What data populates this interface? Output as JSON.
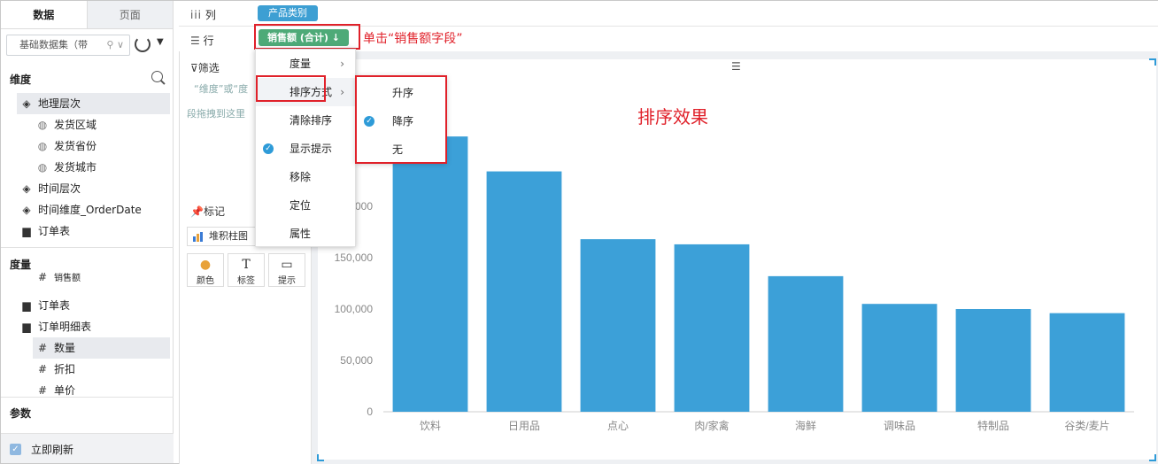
{
  "tabs": [
    "数据",
    "页面"
  ],
  "dataset": {
    "name": "基础数据集（带"
  },
  "dimensions": {
    "title": "维度",
    "items": [
      {
        "label": "地理层次",
        "icon": "layers-icon",
        "level": 0
      },
      {
        "label": "发货区域",
        "icon": "globe-icon",
        "level": 1
      },
      {
        "label": "发货省份",
        "icon": "globe-icon",
        "level": 1
      },
      {
        "label": "发货城市",
        "icon": "globe-icon",
        "level": 1
      },
      {
        "label": "时间层次",
        "icon": "layers-icon",
        "level": 0
      },
      {
        "label": "时间维度_OrderDate",
        "icon": "layers-icon",
        "level": 0
      },
      {
        "label": "订单表",
        "icon": "folder-icon",
        "level": 0
      }
    ]
  },
  "measures": {
    "title": "度量",
    "items": [
      {
        "label": "销售额",
        "icon": "hash-icon",
        "level": 1
      },
      {
        "label": "订单表",
        "icon": "folder-icon",
        "level": 0
      },
      {
        "label": "订单明细表",
        "icon": "folder-open-icon",
        "level": 0
      },
      {
        "label": "数量",
        "icon": "hash-icon",
        "level": 1
      },
      {
        "label": "折扣",
        "icon": "hash-icon",
        "level": 1
      },
      {
        "label": "单价",
        "icon": "hash-icon",
        "level": 1
      }
    ]
  },
  "params": {
    "title": "参数"
  },
  "refresh": {
    "label": "立即刷新"
  },
  "shelves": {
    "columns_label": "列",
    "rows_label": "行",
    "column_pill": "产品类别",
    "row_pill": "销售额 (合计) ↓"
  },
  "annotations": {
    "click_note": "单击“销售额字段”",
    "effect_note": "排序效果"
  },
  "filter": {
    "title": "筛选",
    "hint": "“维度”或“度",
    "hint2": "段拖拽到这里"
  },
  "marks": {
    "title": "标记",
    "chart_type": "堆积柱图",
    "buttons": [
      "颜色",
      "标签",
      "提示"
    ]
  },
  "context_menu": [
    {
      "label": "度量",
      "submenu": true
    },
    {
      "label": "排序方式",
      "submenu": true,
      "highlighted": true
    },
    {
      "label": "清除排序"
    },
    {
      "label": "显示提示",
      "checked": true
    },
    {
      "label": "移除"
    },
    {
      "label": "定位"
    },
    {
      "label": "属性"
    }
  ],
  "sort_menu": [
    {
      "label": "升序"
    },
    {
      "label": "降序",
      "checked": true
    },
    {
      "label": "无"
    }
  ],
  "colors": {
    "bar": "#3ca0d8",
    "accent": "#2e9bd8",
    "annotation": "#e0212a",
    "sales_pill": "#4eaa78",
    "category_pill": "#3d9fd3"
  },
  "chart_data": {
    "type": "bar",
    "categories": [
      "饮料",
      "日用品",
      "点心",
      "肉/家禽",
      "海鲜",
      "调味品",
      "特制品",
      "谷类/麦片"
    ],
    "values": [
      268000,
      234000,
      168000,
      163000,
      132000,
      105000,
      100000,
      96000
    ],
    "ylim": [
      0,
      300000
    ],
    "yticks": [
      0,
      50000,
      100000,
      150000,
      200000,
      250000
    ],
    "ytick_labels": [
      "0",
      "50,000",
      "100,000",
      "150,000",
      "200,000",
      "250,000"
    ],
    "title": "",
    "xlabel": "",
    "ylabel": ""
  }
}
